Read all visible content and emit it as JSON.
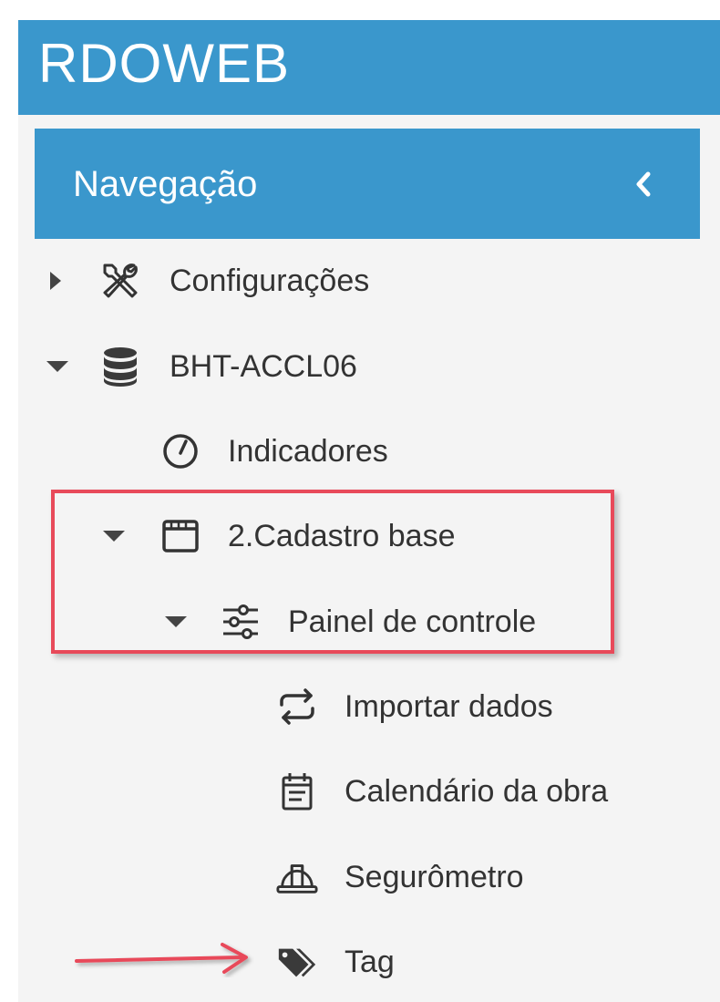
{
  "app": {
    "brand": "RDOWEB"
  },
  "navigation": {
    "title": "Navegação"
  },
  "tree": {
    "configuracoes": "Configurações",
    "project": "BHT-ACCL06",
    "indicadores": "Indicadores",
    "cadastro_base": "2.Cadastro base",
    "painel_controle": "Painel de controle",
    "importar_dados": "Importar dados",
    "calendario": "Calendário da obra",
    "segurometro": "Segurômetro",
    "tag": "Tag"
  },
  "colors": {
    "header_blue": "#3a97cc",
    "highlight_red": "#e84a5a",
    "text": "#333333"
  }
}
